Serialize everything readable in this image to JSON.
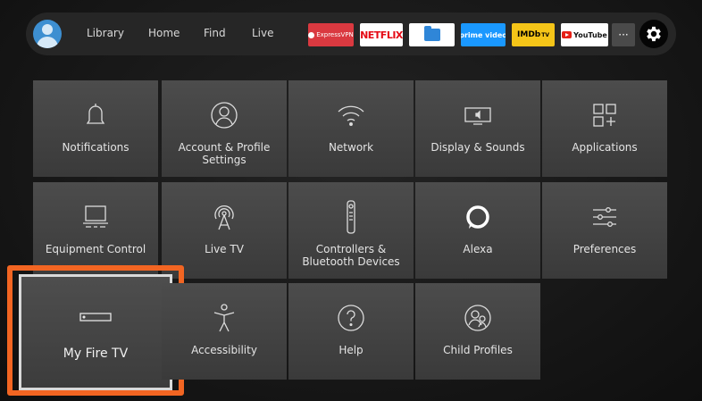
{
  "nav": {
    "items": [
      "Library",
      "Home",
      "Find",
      "Live"
    ],
    "apps": {
      "expressvpn": "ExpressVPN",
      "netflix": "NETFLIX",
      "prime_video": "prime video",
      "imdb": "IMDb",
      "imdb_tv": "TV",
      "youtube": "YouTube",
      "more": "···"
    }
  },
  "settings": {
    "tiles": [
      {
        "label": "Notifications",
        "icon": "bell-icon"
      },
      {
        "label": "Account & Profile Settings",
        "icon": "person-icon"
      },
      {
        "label": "Network",
        "icon": "wifi-icon"
      },
      {
        "label": "Display & Sounds",
        "icon": "monitor-sound-icon"
      },
      {
        "label": "Applications",
        "icon": "apps-grid-icon"
      },
      {
        "label": "Equipment Control",
        "icon": "tv-equipment-icon"
      },
      {
        "label": "Live TV",
        "icon": "antenna-icon"
      },
      {
        "label": "Controllers & Bluetooth Devices",
        "icon": "remote-icon"
      },
      {
        "label": "Alexa",
        "icon": "alexa-ring-icon"
      },
      {
        "label": "Preferences",
        "icon": "sliders-icon"
      },
      {
        "label": "My Fire TV",
        "icon": "fire-tv-device-icon"
      },
      {
        "label": "Accessibility",
        "icon": "accessibility-person-icon"
      },
      {
        "label": "Help",
        "icon": "help-question-icon"
      },
      {
        "label": "Child Profiles",
        "icon": "child-profiles-icon"
      }
    ]
  },
  "colors": {
    "focus": "#f26522",
    "tile": "#444444",
    "navbar": "#262626"
  }
}
